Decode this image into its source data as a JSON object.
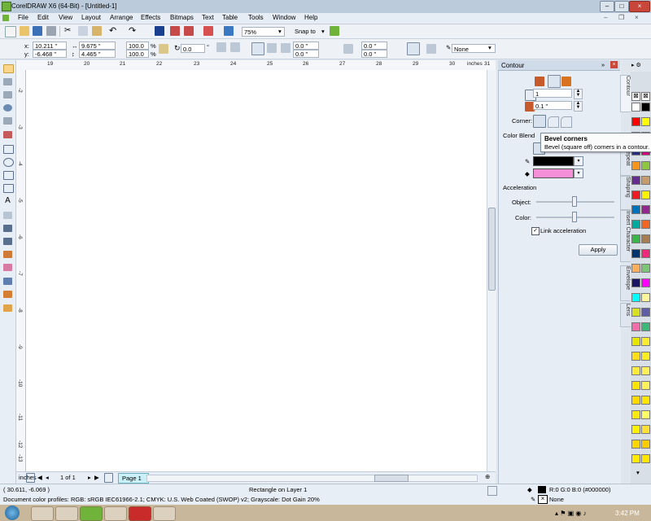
{
  "window": {
    "title": "CorelDRAW X6 (64-Bit) - [Untitled-1]",
    "minimize": "–",
    "maximize": "□",
    "close": "×"
  },
  "menu": [
    "File",
    "Edit",
    "View",
    "Layout",
    "Arrange",
    "Effects",
    "Bitmaps",
    "Text",
    "Table",
    "Tools",
    "Window",
    "Help"
  ],
  "toolbar": {
    "zoom_value": "75%",
    "snap_label": "Snap to"
  },
  "property_bar": {
    "x_label": "x:",
    "x_value": "10.211 \"",
    "y_label": "y:",
    "y_value": "-6.468 \"",
    "w_value": "9.675 \"",
    "h_value": "4.465 \"",
    "scale_x": "100.0",
    "scale_y": "100.0",
    "percent": "%",
    "rotation": "0.0",
    "degree": "°",
    "corner_vals": [
      "0.0 \"",
      "0.0 \"",
      "0.0 \"",
      "0.0 \""
    ],
    "outline_value": "None"
  },
  "ruler": {
    "h_numbers": [
      "19",
      "20",
      "21",
      "22",
      "23",
      "24",
      "25",
      "26",
      "27",
      "28",
      "29",
      "30",
      "31"
    ],
    "units": "inches",
    "v_numbers": [
      "-2",
      "-3",
      "-4",
      "-5",
      "-6",
      "-7",
      "-8",
      "-9",
      "-10",
      "-11",
      "-12",
      "-13",
      "-14"
    ]
  },
  "page_nav": {
    "counter": "1 of 1",
    "tab": "Page 1"
  },
  "docker": {
    "title": "Contour",
    "steps_value": "1",
    "offset_value": "0.1 \"",
    "corner_label": "Corner:",
    "color_blend_label": "Color Blend",
    "acceleration_label": "Acceleration",
    "object_label": "Object:",
    "color_label": "Color:",
    "link_label": "Link acceleration",
    "apply_label": "Apply",
    "side_tabs": [
      "Contour",
      "Repeat",
      "Shaping",
      "Insert Character",
      "Envelope",
      "Lens"
    ]
  },
  "tooltip": {
    "title": "Bevel corners",
    "body": "Bevel (square off) corners in a contour."
  },
  "status": {
    "coords": "( 30.611, -6.069 )",
    "object_info": "Rectangle on Layer 1",
    "fill_info": "R:0 G:0 B:0 (#000000)",
    "outline_info": "None",
    "profiles": "Document color profiles: RGB: sRGB IEC61966-2.1; CMYK: U.S. Web Coated (SWOP) v2; Grayscale: Dot Gain 20%"
  },
  "taskbar": {
    "time": "3:42 PM"
  },
  "colors": {
    "accent": "#6fb33b",
    "fill_color": "#000000",
    "outline_color": "#f58fd8",
    "selected_tool": "#fbd68a"
  },
  "palette_colors": [
    "#ffffff",
    "#000000",
    "#ff0000",
    "#ffff00",
    "#00a650",
    "#00aeef",
    "#2e3192",
    "#ec008c",
    "#f7941d",
    "#8dc63f",
    "#662d91",
    "#c69c6d",
    "#ed1c24",
    "#fff200",
    "#0072bc",
    "#92278f",
    "#00a99d",
    "#f26522",
    "#39b54a",
    "#a67c52",
    "#003471",
    "#ee2a7b",
    "#fbaf5d",
    "#7cc576",
    "#1b1464",
    "#ff00ff",
    "#00ffff",
    "#fff799",
    "#d7df23",
    "#605ca8",
    "#f06eaa",
    "#3cb878",
    "#e6e600",
    "#f9ed32",
    "#ffde17",
    "#fcee21",
    "#ffeb3b",
    "#ffef5a",
    "#f9e400",
    "#fff35c",
    "#fdd900",
    "#ffe600",
    "#fbe80c",
    "#ffff66",
    "#fff200",
    "#ffe135",
    "#ffd700",
    "#ffcc00",
    "#ffea00",
    "#ffe500"
  ]
}
